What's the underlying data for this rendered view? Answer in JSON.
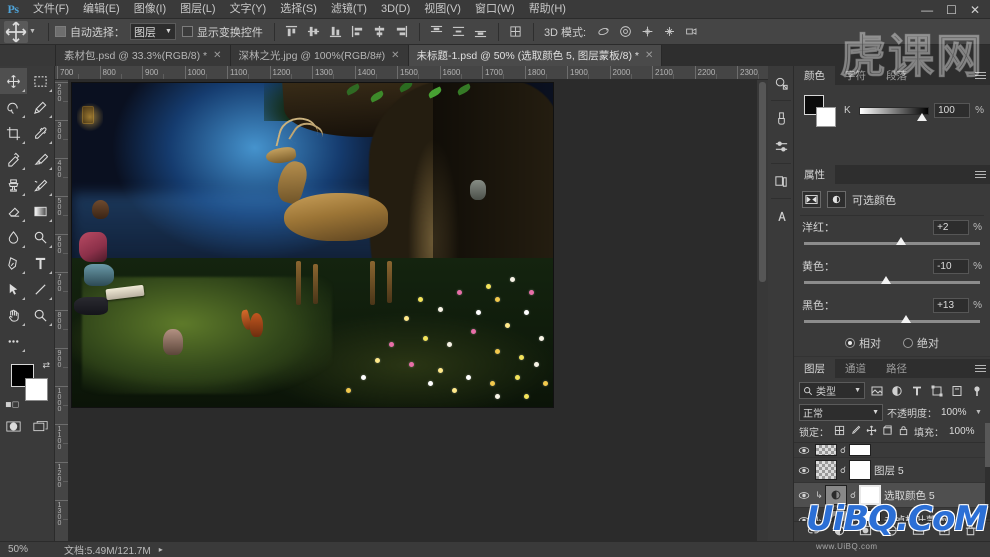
{
  "app": {
    "logo": "Ps",
    "window_controls": [
      "minimize",
      "maximize",
      "close"
    ]
  },
  "menubar": {
    "items": [
      {
        "label": "文件(F)",
        "name": "menu-file"
      },
      {
        "label": "编辑(E)",
        "name": "menu-edit"
      },
      {
        "label": "图像(I)",
        "name": "menu-image"
      },
      {
        "label": "图层(L)",
        "name": "menu-layer"
      },
      {
        "label": "文字(Y)",
        "name": "menu-type"
      },
      {
        "label": "选择(S)",
        "name": "menu-select"
      },
      {
        "label": "滤镜(T)",
        "name": "menu-filter"
      },
      {
        "label": "3D(D)",
        "name": "menu-3d"
      },
      {
        "label": "视图(V)",
        "name": "menu-view"
      },
      {
        "label": "窗口(W)",
        "name": "menu-window"
      },
      {
        "label": "帮助(H)",
        "name": "menu-help"
      }
    ]
  },
  "options_bar": {
    "tool_icon": "move-icon",
    "auto_select_label": "自动选择：",
    "auto_select_value": "图层",
    "show_transform_label": "显示变换控件",
    "show_transform_checked": false,
    "mode3d_label": "3D 模式:",
    "align_buttons": [
      "align-top-edges",
      "align-vertical-centers",
      "align-bottom-edges",
      "align-left-edges",
      "align-horizontal-centers",
      "align-right-edges"
    ],
    "distribute_buttons": [
      "distribute-top",
      "distribute-vertical-center",
      "distribute-bottom"
    ],
    "extra_button": "align-options",
    "mode3d_buttons": [
      "rotate-3d",
      "roll-3d",
      "pan-3d",
      "slide-3d",
      "scale-3d"
    ]
  },
  "tabs": [
    {
      "label": "素材包.psd @ 33.3%(RGB/8) *",
      "active": false,
      "closeable": true
    },
    {
      "label": "深林之光.jpg @ 100%(RGB/8#)",
      "active": false,
      "closeable": true
    },
    {
      "label": "未标题-1.psd @ 50% (选取颜色 5, 图层蒙板/8) *",
      "active": true,
      "closeable": true
    }
  ],
  "toolbox": {
    "tools": [
      {
        "name": "move-tool",
        "icon": "move-icon",
        "selected": true
      },
      {
        "name": "rectangular-marquee-tool",
        "icon": "marquee-icon",
        "selected": false
      },
      {
        "name": "lasso-tool",
        "icon": "lasso-icon",
        "selected": false
      },
      {
        "name": "quick-selection-tool",
        "icon": "quick-select-icon",
        "selected": false
      },
      {
        "name": "crop-tool",
        "icon": "crop-icon",
        "selected": false
      },
      {
        "name": "eyedropper-tool",
        "icon": "eyedropper-icon",
        "selected": false
      },
      {
        "name": "spot-healing-brush-tool",
        "icon": "healing-icon",
        "selected": false
      },
      {
        "name": "brush-tool",
        "icon": "brush-icon",
        "selected": false
      },
      {
        "name": "clone-stamp-tool",
        "icon": "stamp-icon",
        "selected": false
      },
      {
        "name": "history-brush-tool",
        "icon": "history-brush-icon",
        "selected": false
      },
      {
        "name": "eraser-tool",
        "icon": "eraser-icon",
        "selected": false
      },
      {
        "name": "gradient-tool",
        "icon": "gradient-icon",
        "selected": false
      },
      {
        "name": "blur-tool",
        "icon": "blur-icon",
        "selected": false
      },
      {
        "name": "dodge-tool",
        "icon": "dodge-icon",
        "selected": false
      },
      {
        "name": "pen-tool",
        "icon": "pen-icon",
        "selected": false
      },
      {
        "name": "type-tool",
        "icon": "type-icon",
        "selected": false
      },
      {
        "name": "path-selection-tool",
        "icon": "path-select-icon",
        "selected": false
      },
      {
        "name": "line-tool",
        "icon": "line-icon",
        "selected": false
      },
      {
        "name": "hand-tool",
        "icon": "hand-icon",
        "selected": false
      },
      {
        "name": "zoom-tool",
        "icon": "zoom-icon",
        "selected": false
      },
      {
        "name": "edit-toolbar-button",
        "icon": "ellipsis-icon",
        "selected": false
      }
    ],
    "foreground_color": "#000000",
    "background_color": "#ffffff",
    "quick_mask": "quick-mask-icon",
    "screen_mode": "screen-mode-icon"
  },
  "rulers": {
    "horizontal_ticks": [
      "700",
      "800",
      "900",
      "1000",
      "1100",
      "1200",
      "1300",
      "1400",
      "1500",
      "1600",
      "1700",
      "1800",
      "1900",
      "2000",
      "2100",
      "2200",
      "2300"
    ],
    "vertical_ticks": [
      "200",
      "300",
      "400",
      "500",
      "600",
      "700",
      "800",
      "900",
      "1000",
      "1100",
      "1200",
      "1300"
    ]
  },
  "canvas": {
    "document": "未标题-1.psd",
    "scene_description": "夜晚森林合成图：女孩读书、鹿、松鼠、猫、大树、花丛、灯笼"
  },
  "icon_rail": {
    "buttons": [
      {
        "name": "navigator-icon",
        "label": "导航器"
      },
      {
        "name": "brush-presets-icon",
        "label": "画笔预设"
      },
      {
        "name": "adjustments-icon",
        "label": "调整"
      },
      {
        "name": "libraries-icon",
        "label": "库"
      },
      {
        "name": "character-styles-icon",
        "label": "字符样式"
      }
    ]
  },
  "color_panel": {
    "tabs": [
      {
        "label": "颜色",
        "active": true
      },
      {
        "label": "字符",
        "active": false
      },
      {
        "label": "段落",
        "active": false
      }
    ],
    "channel_label": "K",
    "channel_value": "100",
    "unit": "%",
    "foreground_color": "#000000",
    "background_color": "#ffffff"
  },
  "properties_panel": {
    "tab_label": "属性",
    "adjustment_title": "可选颜色",
    "sliders": [
      {
        "label": "洋红：",
        "value": "+2",
        "unit": "%",
        "knob_pct": 52
      },
      {
        "label": "黄色：",
        "value": "-10",
        "unit": "%",
        "knob_pct": 46
      },
      {
        "label": "黑色：",
        "value": "+13",
        "unit": "%",
        "knob_pct": 55
      }
    ],
    "method_options": [
      {
        "label": "相对",
        "selected": true
      },
      {
        "label": "绝对",
        "selected": false
      }
    ],
    "footer_buttons": [
      "clip-to-layer-icon",
      "view-previous-state-icon",
      "reset-icon",
      "toggle-visibility-icon",
      "delete-adjustment-icon"
    ]
  },
  "layers_panel": {
    "tabs": [
      {
        "label": "图层",
        "active": true
      },
      {
        "label": "通道",
        "active": false
      },
      {
        "label": "路径",
        "active": false
      }
    ],
    "filter_label": "类型",
    "filter_icons": [
      "filter-pixel-icon",
      "filter-adjustment-icon",
      "filter-type-icon",
      "filter-shape-icon",
      "filter-smart-icon",
      "filter-toggle-icon"
    ],
    "blend_mode": "正常",
    "opacity_label": "不透明度：",
    "opacity_value": "100%",
    "lock_label": "锁定：",
    "lock_icons": [
      "lock-transparent-icon",
      "lock-image-icon",
      "lock-position-icon",
      "lock-artboard-icon",
      "lock-all-icon"
    ],
    "fill_label": "填充：",
    "fill_value": "100%",
    "layers": [
      {
        "name": "",
        "visible": true,
        "selected": false,
        "kind": "partial-top",
        "thumb": "checker",
        "mask": "white"
      },
      {
        "name": "图层 5",
        "visible": true,
        "selected": false,
        "kind": "pixel",
        "thumb": "checker",
        "mask": "white"
      },
      {
        "name": "选取颜色 5",
        "visible": true,
        "selected": true,
        "kind": "adjustment",
        "thumb": "adj",
        "mask": "white"
      },
      {
        "name": "去掉枝叶蒙版",
        "visible": true,
        "selected": false,
        "kind": "adjustment",
        "thumb": "adj",
        "mask": "white"
      }
    ],
    "footer_buttons": [
      "link-layers-icon",
      "layer-style-icon",
      "layer-mask-icon",
      "new-adjustment-icon",
      "new-group-icon",
      "new-layer-icon",
      "delete-layer-icon"
    ]
  },
  "status_bar": {
    "zoom": "50%",
    "doc_info": "文档:5.49M/121.7M"
  },
  "watermarks": {
    "top_right": "虎课网",
    "bottom_right": "UiBQ.CoM",
    "bottom_sub": "www.UiBQ.com"
  }
}
